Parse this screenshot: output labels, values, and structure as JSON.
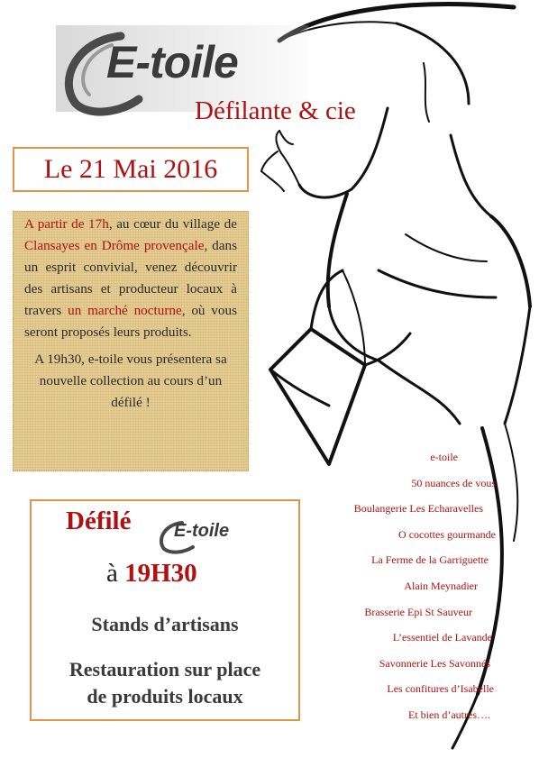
{
  "logo": {
    "text": "E-toile",
    "subtitle": "Défilante & cie"
  },
  "date": "Le 21 Mai 2016",
  "info": {
    "p1": [
      {
        "t": "A partir de 17h",
        "red": true
      },
      {
        "t": ", au cœur du village de ",
        "red": false
      },
      {
        "t": "Clansayes en Drôme provençale",
        "red": true
      },
      {
        "t": ", dans un esprit convivial, venez découvrir des artisans et producteur locaux à travers ",
        "red": false
      },
      {
        "t": "un marché nocturne",
        "red": true
      },
      {
        "t": ", où vous seront proposés  leurs produits.",
        "red": false
      }
    ],
    "p2": "A 19h30, e-toile vous présentera sa nouvelle collection au cours d’un défilé !"
  },
  "defile": {
    "title": "Défilé",
    "mini_logo": "E-toile",
    "time_prefix": "à ",
    "time": "19H30",
    "stands": "Stands d’artisans",
    "resto_line1": "Restauration sur place",
    "resto_line2": "de produits locaux"
  },
  "exhibitors": [
    "e-toile",
    "50 nuances de vous",
    "Boulangerie  Les Echaravelles",
    "O cocottes gourmande",
    "La Ferme de la Garriguette",
    "Alain Meynadier",
    "Brasserie Epi St Sauveur",
    "L’essentiel de Lavande",
    "Savonnerie Les Savonnés",
    "Les  confitures d’Isabelle",
    "Et  bien d’autres…."
  ]
}
